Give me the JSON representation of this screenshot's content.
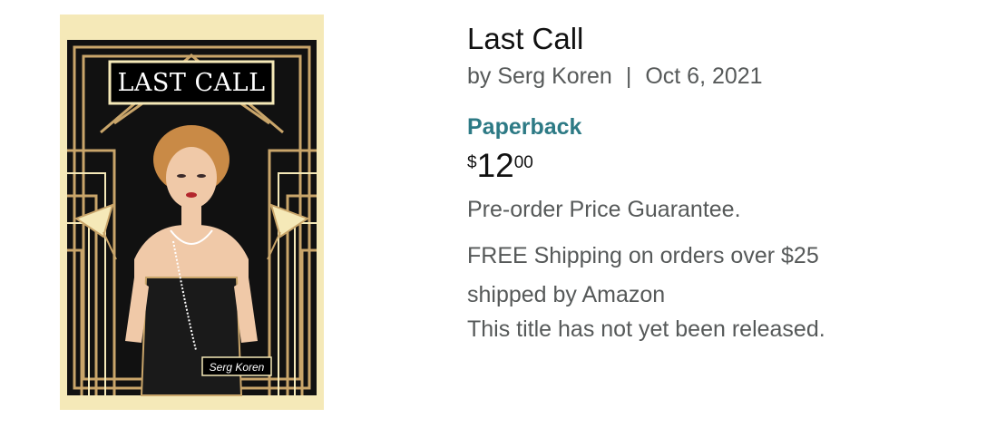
{
  "book": {
    "cover": {
      "title_text": "LAST CALL",
      "author_text": "Serg Koren",
      "colors": {
        "background": "#f5e9b8",
        "pattern": "#111111",
        "gold": "#c9a56a",
        "title_box": "#000000"
      }
    },
    "title": "Last Call",
    "byline": {
      "prefix": "by Serg Koren",
      "separator": "|",
      "date": "Oct 6, 2021"
    },
    "format": "Paperback",
    "price": {
      "symbol": "$",
      "whole": "12",
      "fraction": "00"
    },
    "preorder_note": "Pre-order Price Guarantee.",
    "shipping_line": "FREE Shipping on orders over $25",
    "shipped_by": "shipped by Amazon",
    "release_note": "This title has not yet been released."
  },
  "colors": {
    "format_link": "#2d7a85",
    "secondary_text": "#565959",
    "primary_text": "#111111"
  }
}
